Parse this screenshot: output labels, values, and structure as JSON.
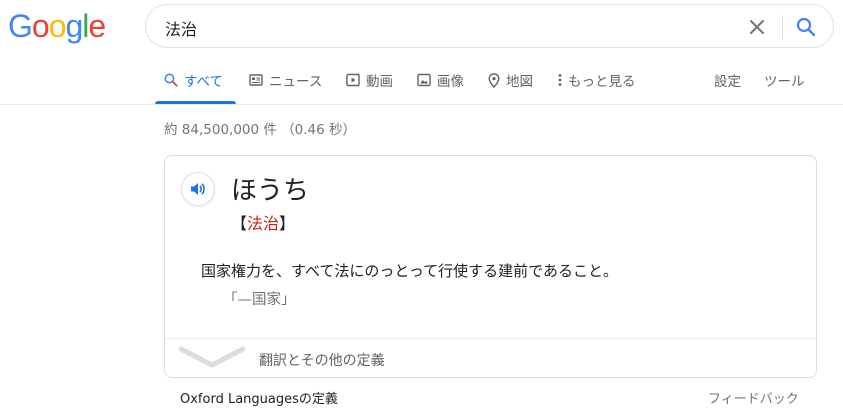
{
  "logo": {
    "letters": [
      "G",
      "o",
      "o",
      "g",
      "l",
      "e"
    ]
  },
  "colors": {
    "google_blue": "#4285f4",
    "google_red": "#ea4335",
    "google_yellow": "#fbbc05",
    "google_green": "#34a853",
    "active_tab": "#1a73e8",
    "kanji_red": "#c5221f"
  },
  "search": {
    "value": "法治"
  },
  "tabs": [
    {
      "label": "すべて",
      "icon": "search-icon",
      "active": true
    },
    {
      "label": "ニュース",
      "icon": "news-icon",
      "active": false
    },
    {
      "label": "動画",
      "icon": "video-icon",
      "active": false
    },
    {
      "label": "画像",
      "icon": "image-icon",
      "active": false
    },
    {
      "label": "地図",
      "icon": "map-pin-icon",
      "active": false
    },
    {
      "label": "もっと見る",
      "icon": "more-vert-icon",
      "active": false
    }
  ],
  "tools": {
    "settings": "設定",
    "tools": "ツール"
  },
  "result_stats": "約 84,500,000 件 （0.46 秒）",
  "dictionary": {
    "headword": "ほうち",
    "bracket_open": "【",
    "kanji": "法治",
    "bracket_close": "】",
    "definition": "国家権力を、すべて法にのっとって行使する建前であること。",
    "example": "「—国家」",
    "expand_label": "翻訳とその他の定義"
  },
  "footer": {
    "source": "Oxford Languagesの定義",
    "feedback": "フィードバック"
  }
}
